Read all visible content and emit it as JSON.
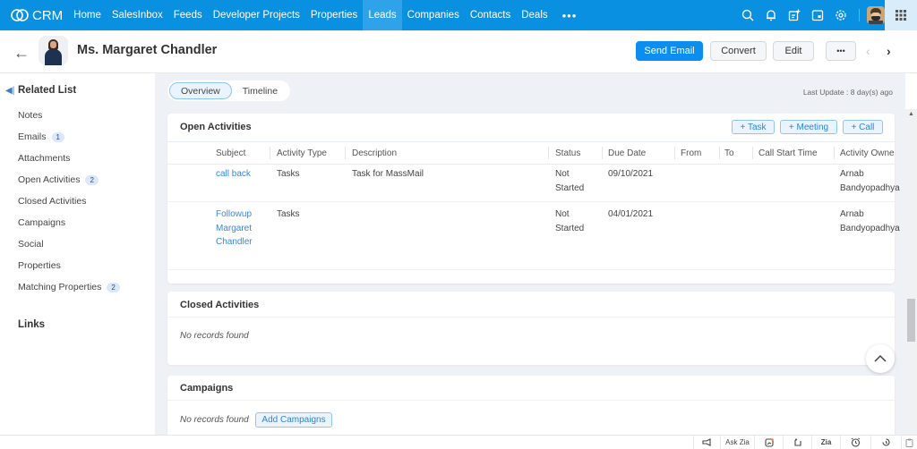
{
  "app": {
    "name": "CRM"
  },
  "nav": {
    "items": [
      {
        "label": "Home"
      },
      {
        "label": "SalesInbox"
      },
      {
        "label": "Feeds"
      },
      {
        "label": "Developer Projects"
      },
      {
        "label": "Properties"
      },
      {
        "label": "Leads",
        "active": true
      },
      {
        "label": "Companies"
      },
      {
        "label": "Contacts"
      },
      {
        "label": "Deals"
      }
    ],
    "more": "•••",
    "icons": [
      "search-icon",
      "bell-icon",
      "add-note-icon",
      "calendar-icon",
      "gear-icon",
      "user-avatar",
      "app-grid-icon"
    ]
  },
  "record": {
    "name": "Ms. Margaret Chandler",
    "actions": {
      "send_email": "Send Email",
      "convert": "Convert",
      "edit": "Edit",
      "more": "•••"
    }
  },
  "sidebar": {
    "title": "Related List",
    "items": [
      {
        "label": "Notes"
      },
      {
        "label": "Emails",
        "badge": "1"
      },
      {
        "label": "Attachments"
      },
      {
        "label": "Open Activities",
        "badge": "2"
      },
      {
        "label": "Closed Activities"
      },
      {
        "label": "Campaigns"
      },
      {
        "label": "Social"
      },
      {
        "label": "Properties"
      },
      {
        "label": "Matching Properties",
        "badge": "2"
      }
    ],
    "links": "Links"
  },
  "tabs": [
    {
      "label": "Overview",
      "active": true
    },
    {
      "label": "Timeline"
    }
  ],
  "last_update": "Last Update : 8 day(s) ago",
  "open_activities": {
    "title": "Open Activities",
    "buttons": {
      "task": "+ Task",
      "meeting": "+ Meeting",
      "call": "+ Call"
    },
    "columns": [
      "Subject",
      "Activity Type",
      "Description",
      "Status",
      "Due Date",
      "From",
      "To",
      "Call Start Time",
      "Activity Owne"
    ],
    "rows": [
      {
        "subject": [
          "call back"
        ],
        "type": "Tasks",
        "description": "Task for MassMail",
        "status": [
          "Not",
          "Started"
        ],
        "due": "09/10/2021",
        "from": "",
        "to": "",
        "call_start": "",
        "owner": [
          "Arnab",
          "Bandyopadhya"
        ]
      },
      {
        "subject": [
          "Followup",
          "Margaret",
          "Chandler"
        ],
        "type": "Tasks",
        "description": "",
        "status": [
          "Not",
          "Started"
        ],
        "due": "04/01/2021",
        "from": "",
        "to": "",
        "call_start": "",
        "owner": [
          "Arnab",
          "Bandyopadhya"
        ]
      }
    ]
  },
  "closed_activities": {
    "title": "Closed Activities",
    "empty": "No records found"
  },
  "campaigns": {
    "title": "Campaigns",
    "empty": "No records found",
    "add_button": "Add Campaigns"
  },
  "bottombar": {
    "ask_zia": "Ask Zia",
    "zia_label": "Zia"
  }
}
